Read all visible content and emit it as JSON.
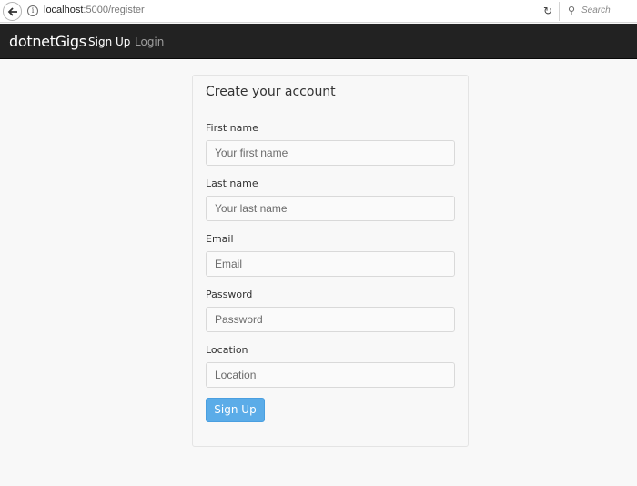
{
  "browser": {
    "url_host": "localhost",
    "url_path": ":5000/register",
    "search_placeholder": "Search"
  },
  "navbar": {
    "brand": "dotnetGigs",
    "links": [
      {
        "label": "Sign Up",
        "active": true
      },
      {
        "label": "Login",
        "active": false
      }
    ]
  },
  "form": {
    "title": "Create your account",
    "fields": [
      {
        "label": "First name",
        "placeholder": "Your first name"
      },
      {
        "label": "Last name",
        "placeholder": "Your last name"
      },
      {
        "label": "Email",
        "placeholder": "Email"
      },
      {
        "label": "Password",
        "placeholder": "Password"
      },
      {
        "label": "Location",
        "placeholder": "Location"
      }
    ],
    "submit_label": "Sign Up"
  },
  "colors": {
    "navbar_bg": "#222222",
    "button_bg": "#5bace8",
    "page_bg": "#f8f8f8"
  }
}
